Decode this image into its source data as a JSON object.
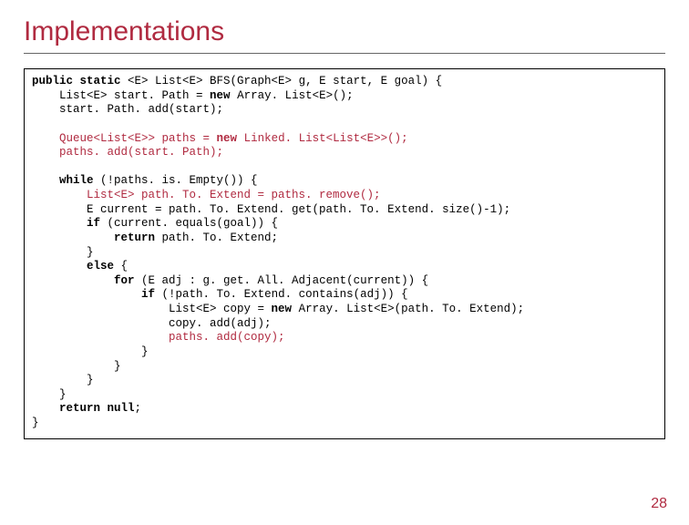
{
  "title": "Implementations",
  "page_number": "28",
  "code": {
    "l01a": "public static",
    "l01b": " <E> List<E> BFS(Graph<E> g, E start, E goal) {",
    "l02": "    List<E> start. Path = ",
    "l02n": "new",
    "l02b": " Array. List<E>();",
    "l03": "    start. Path. add(start);",
    "blank1": "",
    "l04a": "    Queue<List<E>> paths = ",
    "l04n": "new",
    "l04b": " Linked. List<List<E>>();",
    "l05": "    paths. add(start. Path);",
    "blank2": "",
    "l06a": "    ",
    "l06w": "while",
    "l06b": " (!paths. is. Empty()) {",
    "l07": "        List<E> path. To. Extend = paths. remove();",
    "l08": "        E current = path. To. Extend. get(path. To. Extend. size()-1);",
    "l09a": "        ",
    "l09i": "if",
    "l09b": " (current. equals(goal)) {",
    "l10a": "            ",
    "l10r": "return",
    "l10b": " path. To. Extend;",
    "l11": "        }",
    "l12a": "        ",
    "l12e": "else",
    "l12b": " {",
    "l13a": "            ",
    "l13f": "for",
    "l13b": " (E adj : g. get. All. Adjacent(current)) {",
    "l14a": "                ",
    "l14i": "if",
    "l14b": " (!path. To. Extend. contains(adj)) {",
    "l15a": "                    List<E> copy = ",
    "l15n": "new",
    "l15b": " Array. List<E>(path. To. Extend);",
    "l16": "                    copy. add(adj);",
    "l17": "                    paths. add(copy);",
    "l18": "                }",
    "l19": "            }",
    "l20": "        }",
    "l21": "    }",
    "l22a": "    ",
    "l22r": "return null",
    "l22b": ";",
    "l23": "}"
  }
}
